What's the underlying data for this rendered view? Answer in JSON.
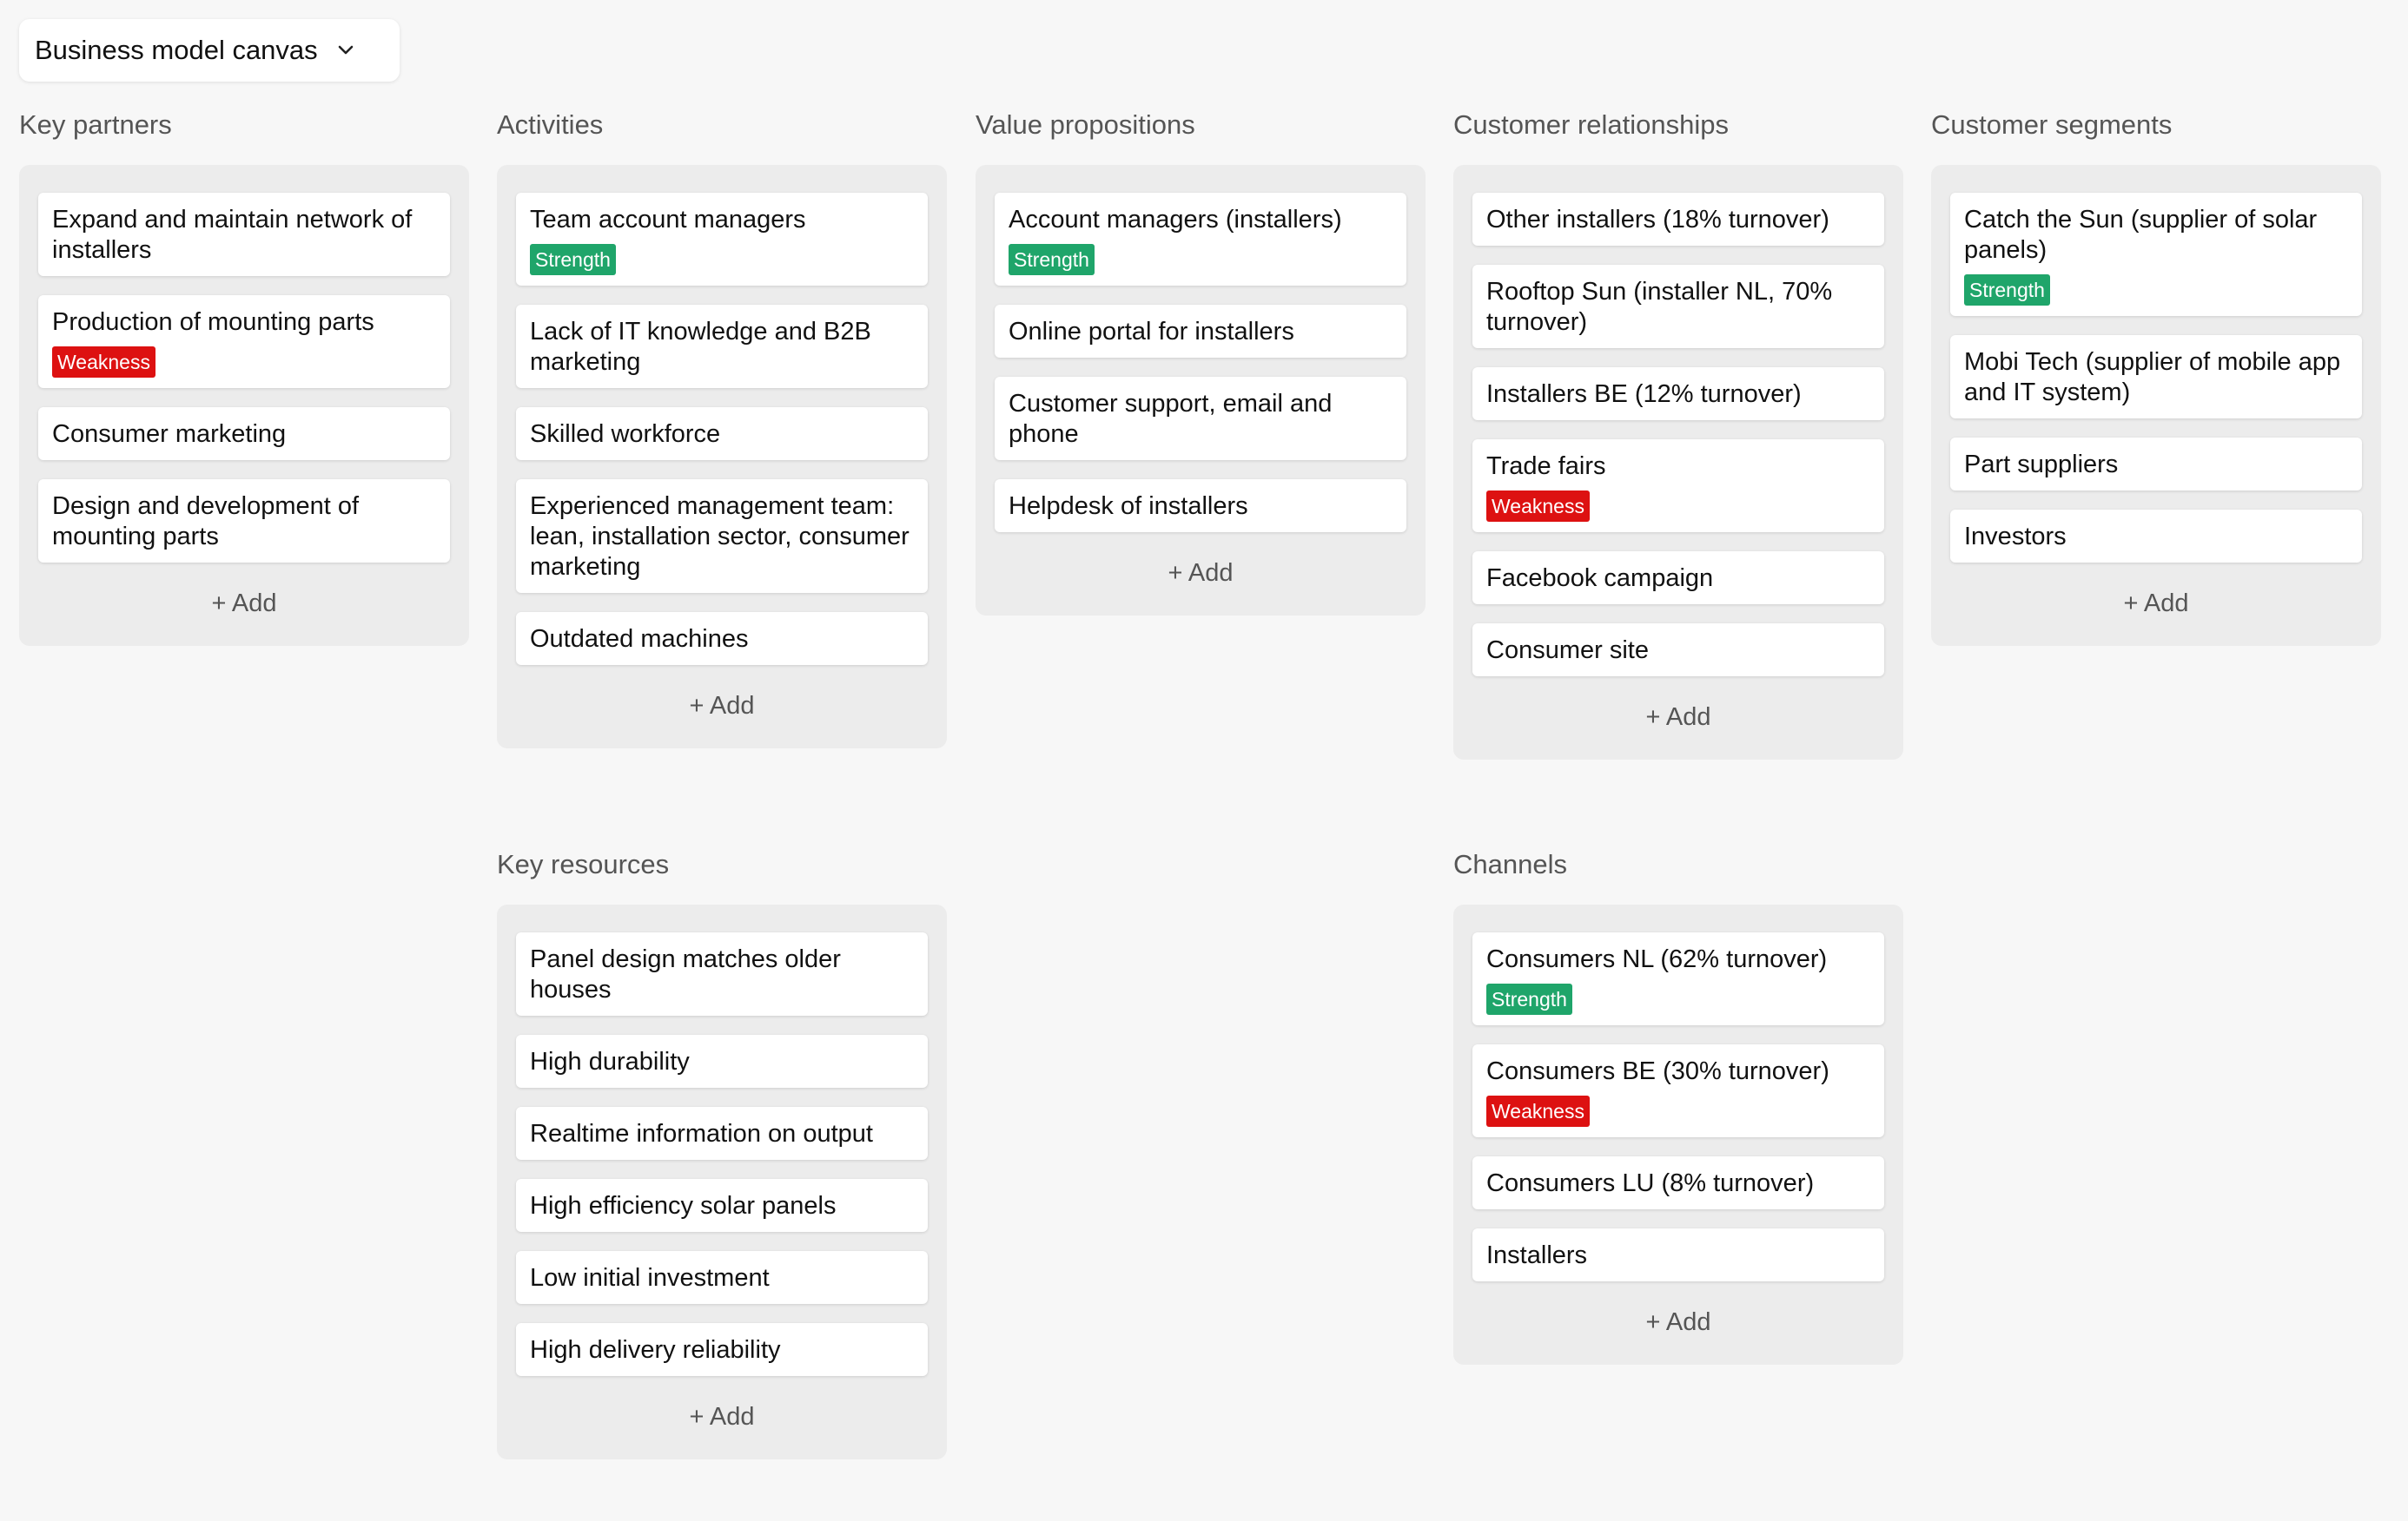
{
  "board": {
    "title": "Business model canvas",
    "dropdown_icon": "chevron-down-icon"
  },
  "colors": {
    "strength": "#1fa56a",
    "weakness": "#dd1111",
    "panel": "#ececec",
    "background": "#f7f7f7"
  },
  "add_label": "+ Add",
  "columns": {
    "key_partners": {
      "title": "Key partners",
      "cards": [
        {
          "text": "Expand and maintain network of installers"
        },
        {
          "text": "Production of mounting parts",
          "badge": "Weakness"
        },
        {
          "text": "Consumer marketing"
        },
        {
          "text": "Design and development of mounting parts"
        }
      ]
    },
    "activities": {
      "title": "Activities",
      "cards": [
        {
          "text": "Team account managers",
          "badge": "Strength"
        },
        {
          "text": "Lack of IT knowledge and B2B marketing"
        },
        {
          "text": "Skilled workforce"
        },
        {
          "text": "Experienced management team: lean, installation sector, consumer marketing"
        },
        {
          "text": "Outdated machines"
        }
      ]
    },
    "key_resources": {
      "title": "Key resources",
      "cards": [
        {
          "text": "Panel design matches older houses"
        },
        {
          "text": "High durability"
        },
        {
          "text": "Realtime information on output"
        },
        {
          "text": "High efficiency solar panels"
        },
        {
          "text": "Low initial investment"
        },
        {
          "text": "High delivery reliability"
        }
      ]
    },
    "value_propositions": {
      "title": "Value propositions",
      "cards": [
        {
          "text": "Account managers (installers)",
          "badge": "Strength"
        },
        {
          "text": "Online portal for installers"
        },
        {
          "text": "Customer support, email and phone"
        },
        {
          "text": "Helpdesk of installers"
        }
      ]
    },
    "customer_relationships": {
      "title": "Customer relationships",
      "cards": [
        {
          "text": "Other installers (18% turnover)"
        },
        {
          "text": "Rooftop Sun (installer NL, 70% turnover)"
        },
        {
          "text": "Installers BE (12% turnover)"
        },
        {
          "text": "Trade fairs",
          "badge": "Weakness"
        },
        {
          "text": "Facebook campaign"
        },
        {
          "text": "Consumer site"
        }
      ]
    },
    "channels": {
      "title": "Channels",
      "cards": [
        {
          "text": "Consumers NL (62% turnover)",
          "badge": "Strength"
        },
        {
          "text": "Consumers BE (30% turnover)",
          "badge": "Weakness"
        },
        {
          "text": "Consumers LU (8% turnover)"
        },
        {
          "text": "Installers"
        }
      ]
    },
    "customer_segments": {
      "title": "Customer segments",
      "cards": [
        {
          "text": "Catch the Sun (supplier of solar panels)",
          "badge": "Strength"
        },
        {
          "text": "Mobi Tech (supplier of mobile app and IT system)"
        },
        {
          "text": "Part suppliers"
        },
        {
          "text": "Investors"
        }
      ]
    }
  }
}
